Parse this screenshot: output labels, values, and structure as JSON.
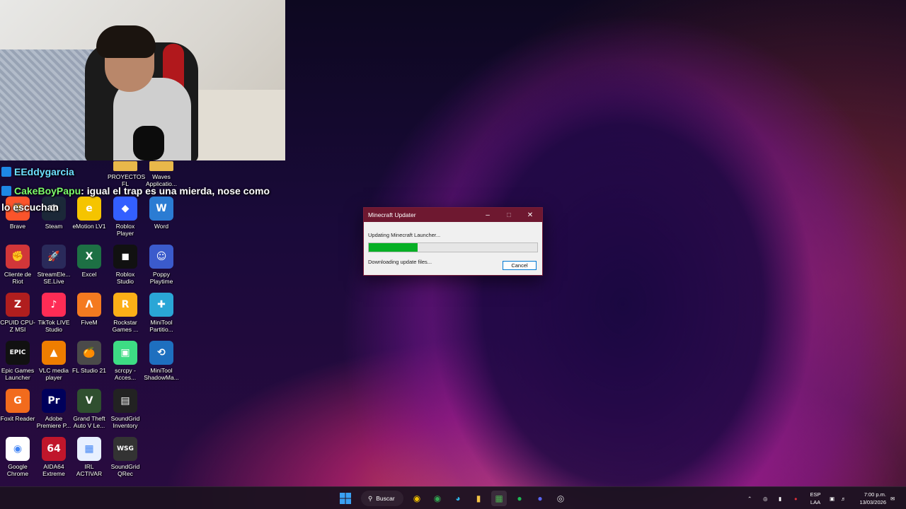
{
  "chat": {
    "line1_user": "EEddygarcia",
    "line2_user": "CakeBoyPapu",
    "line2_message": ": igual el trap es una mierda, nose como",
    "line3_message": "lo escuchan"
  },
  "desktop": {
    "partial_row": [
      "PROYECTOS FL",
      "Waves Applicatio..."
    ],
    "icons": [
      {
        "label": "Brave",
        "icon": "brave-icon",
        "color": "#fb542b",
        "glyph": "🦁"
      },
      {
        "label": "Steam",
        "icon": "steam-icon",
        "color": "#1b2838",
        "glyph": "⚙"
      },
      {
        "label": "eMotion LV1",
        "icon": "emotion-icon",
        "color": "#f5c400",
        "glyph": "e"
      },
      {
        "label": "Roblox Player",
        "icon": "roblox-player-icon",
        "color": "#335fff",
        "glyph": "◆"
      },
      {
        "label": "Word",
        "icon": "word-icon",
        "color": "#2b7cd3",
        "glyph": "W"
      },
      {
        "label": "Cliente de Riot",
        "icon": "riot-icon",
        "color": "#d13639",
        "glyph": "✊"
      },
      {
        "label": "StreamEle... SE.Live",
        "icon": "streamelements-icon",
        "color": "#2a2a5a",
        "glyph": "🚀"
      },
      {
        "label": "Excel",
        "icon": "excel-icon",
        "color": "#1d7044",
        "glyph": "X"
      },
      {
        "label": "Roblox Studio",
        "icon": "roblox-studio-icon",
        "color": "#111111",
        "glyph": "◼"
      },
      {
        "label": "Poppy Playtime",
        "icon": "poppy-icon",
        "color": "#3b5bcc",
        "glyph": "☺"
      },
      {
        "label": "CPUID CPU-Z MSI",
        "icon": "cpuz-icon",
        "color": "#b01e1e",
        "glyph": "Z"
      },
      {
        "label": "TikTok LIVE Studio",
        "icon": "tiktok-icon",
        "color": "#fe2c55",
        "glyph": "♪"
      },
      {
        "label": "FiveM",
        "icon": "fivem-icon",
        "color": "#f47a20",
        "glyph": "Λ"
      },
      {
        "label": "Rockstar Games ...",
        "icon": "rockstar-icon",
        "color": "#fcaf17",
        "glyph": "R"
      },
      {
        "label": "MiniTool Partitio...",
        "icon": "minitool-partition-icon",
        "color": "#2aa6d6",
        "glyph": "✚"
      },
      {
        "label": "Epic Games Launcher",
        "icon": "epic-icon",
        "color": "#111111",
        "glyph": "EPIC"
      },
      {
        "label": "VLC media player",
        "icon": "vlc-icon",
        "color": "#ee7d00",
        "glyph": "▲"
      },
      {
        "label": "FL Studio 21",
        "icon": "fl-studio-icon",
        "color": "#4a4a4a",
        "glyph": "🍊"
      },
      {
        "label": "scrcpy - Acces...",
        "icon": "scrcpy-icon",
        "color": "#3ddc84",
        "glyph": "▣"
      },
      {
        "label": "MiniTool ShadowMa...",
        "icon": "minitool-shadowmaker-icon",
        "color": "#1e6fbf",
        "glyph": "⟲"
      },
      {
        "label": "Foxit Reader",
        "icon": "foxit-icon",
        "color": "#f26b1d",
        "glyph": "G"
      },
      {
        "label": "Adobe Premiere P...",
        "icon": "premiere-icon",
        "color": "#00005b",
        "glyph": "Pr"
      },
      {
        "label": "Grand Theft Auto V Le...",
        "icon": "gta-icon",
        "color": "#2f4f2f",
        "glyph": "V"
      },
      {
        "label": "SoundGrid Inventory",
        "icon": "soundgrid-inventory-icon",
        "color": "#222222",
        "glyph": "▤"
      },
      {
        "label": "",
        "icon": "",
        "color": "",
        "glyph": ""
      },
      {
        "label": "Google Chrome",
        "icon": "chrome-icon",
        "color": "#ffffff",
        "glyph": "◉"
      },
      {
        "label": "AIDA64 Extreme",
        "icon": "aida64-icon",
        "color": "#c0162b",
        "glyph": "64"
      },
      {
        "label": "IRL ACTIVAR",
        "icon": "irl-activar-icon",
        "color": "#e8f0ff",
        "glyph": "▦"
      },
      {
        "label": "SoundGrid QRec",
        "icon": "soundgrid-qrec-icon",
        "color": "#333333",
        "glyph": "WSG"
      }
    ]
  },
  "dialog": {
    "title": "Minecraft Updater",
    "message": "Updating Minecraft Launcher...",
    "progress": 0.29,
    "status": "Downloading update files...",
    "cancel_label": "Cancel"
  },
  "taskbar": {
    "search_label": "Buscar",
    "lang_top": "ESP",
    "lang_bottom": "LAA",
    "time": "7:00 p.m.",
    "date": "13/03/2026"
  },
  "colors": {
    "dialog_titlebar": "#6e1830",
    "progress_fill": "#06b025",
    "chat_user1": "#6de0ff",
    "chat_user2": "#7dfc6a"
  }
}
